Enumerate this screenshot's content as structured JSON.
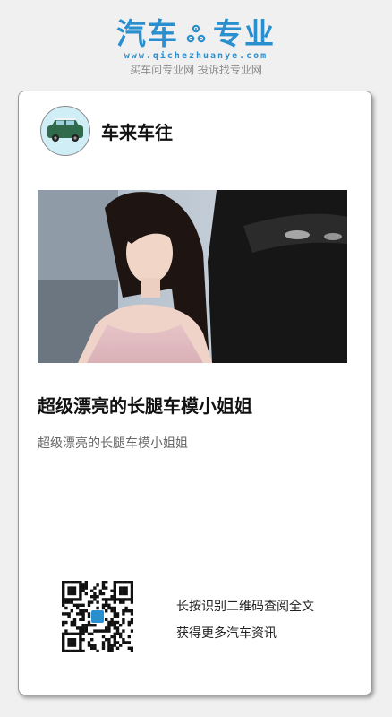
{
  "brand": {
    "logo_left": "汽车",
    "logo_right": "专业",
    "url": "www.qichezhuanye.com",
    "slogan": "买车问专业网 投诉找专业网",
    "accent_color": "#2a8fcf",
    "logo_icon": "gear-icon"
  },
  "author": {
    "name": "车来车往",
    "avatar_icon": "car-icon"
  },
  "article": {
    "title": "超级漂亮的长腿车模小姐姐",
    "summary": "超级漂亮的长腿车模小姐姐"
  },
  "qr": {
    "line1": "长按识别二维码查阅全文",
    "line2": "获得更多汽车资讯"
  }
}
